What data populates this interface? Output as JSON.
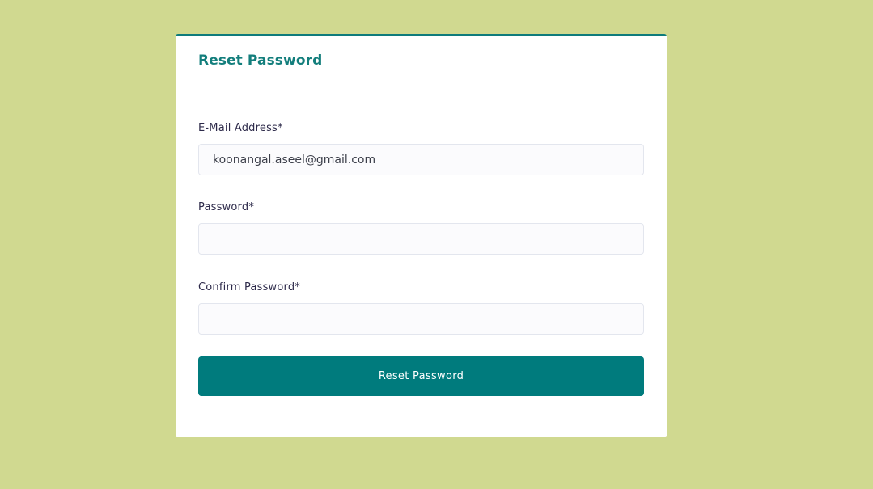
{
  "form": {
    "title": "Reset Password",
    "email": {
      "label": "E-Mail Address*",
      "value": "koonangal.aseel@gmail.com"
    },
    "password": {
      "label": "Password*",
      "value": ""
    },
    "confirm_password": {
      "label": "Confirm Password*",
      "value": ""
    },
    "submit_label": "Reset Password"
  },
  "colors": {
    "background": "#d0d990",
    "accent": "#007b7d",
    "title": "#137e7c"
  }
}
